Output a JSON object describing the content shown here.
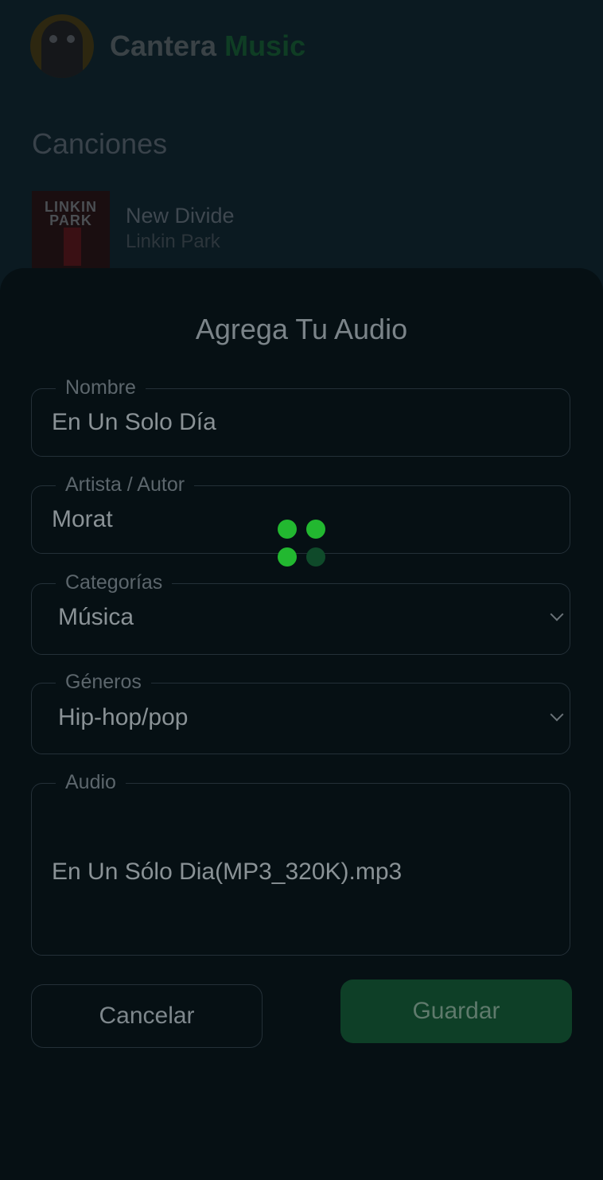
{
  "app": {
    "brand_primary": "Cantera",
    "brand_accent": "Music",
    "logo_icon": "owl-icon"
  },
  "library": {
    "section_title": "Canciones",
    "songs": [
      {
        "title": "New Divide",
        "artist": "Linkin Park",
        "cover_text": "LINKIN PARK"
      }
    ]
  },
  "dialog": {
    "title": "Agrega Tu Audio",
    "fields": {
      "nombre": {
        "label": "Nombre",
        "value": "En Un Solo Día"
      },
      "artista": {
        "label": "Artista / Autor",
        "value": "Morat"
      },
      "categorias": {
        "label": "Categorías",
        "value": "Música"
      },
      "generos": {
        "label": "Géneros",
        "value": "Hip-hop/pop"
      },
      "audio": {
        "label": "Audio",
        "value": "En Un Sólo Dia(MP3_320K).mp3"
      }
    },
    "cancel_label": "Cancelar",
    "save_label": "Guardar"
  },
  "loader": {
    "dot_colors": [
      "#22b830",
      "#22b830",
      "#22b830",
      "#0f4a2a"
    ]
  },
  "colors": {
    "accent_green": "#22b830",
    "save_button_bg": "#0e3f27",
    "sheet_bg": "#061014"
  }
}
